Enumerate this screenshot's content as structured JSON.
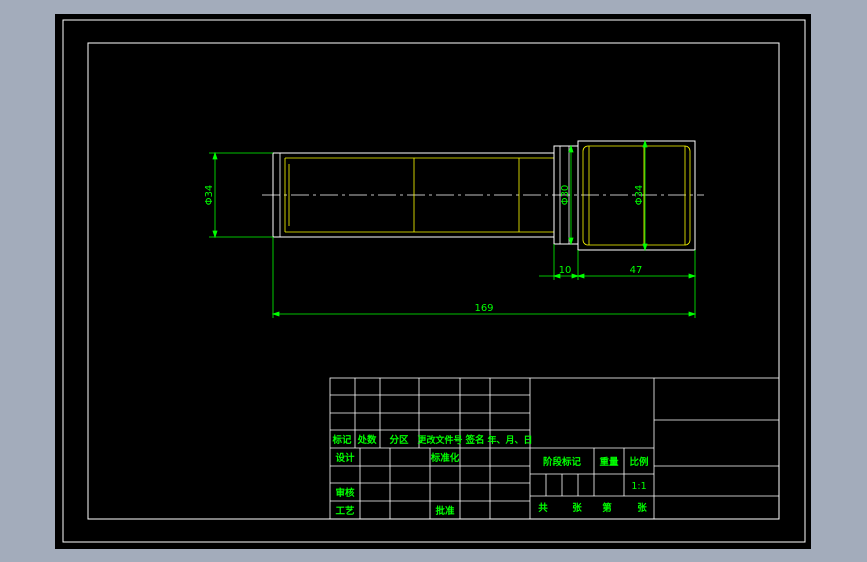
{
  "colors": {
    "background": "#a3acbb",
    "sheet": "#000000",
    "frame": "#ffffff",
    "part_outline": "#ffffff",
    "part_hidden": "#ffff00",
    "dimension": "#00ff00",
    "table_text": "#00ff00"
  },
  "dimensions": {
    "left_diameter": "Φ34",
    "mid_diameter": "Φ30",
    "right_diameter": "Φ34",
    "step_length": "10",
    "head_length": "47",
    "total_length": "169"
  },
  "title_block": {
    "mark": "标记",
    "count": "处数",
    "zone": "分区",
    "change_doc": "更改文件号",
    "signature": "签名",
    "date": "年、月、日",
    "design": "设计",
    "standardize": "标准化",
    "check": "审核",
    "process": "工艺",
    "approve": "批准",
    "stage_mark": "阶段标记",
    "weight": "重量",
    "ratio_label": "比例",
    "ratio_value": "1:1",
    "total": "共",
    "sheets": "张",
    "sheet_no": "第",
    "sheet_unit": "张"
  }
}
